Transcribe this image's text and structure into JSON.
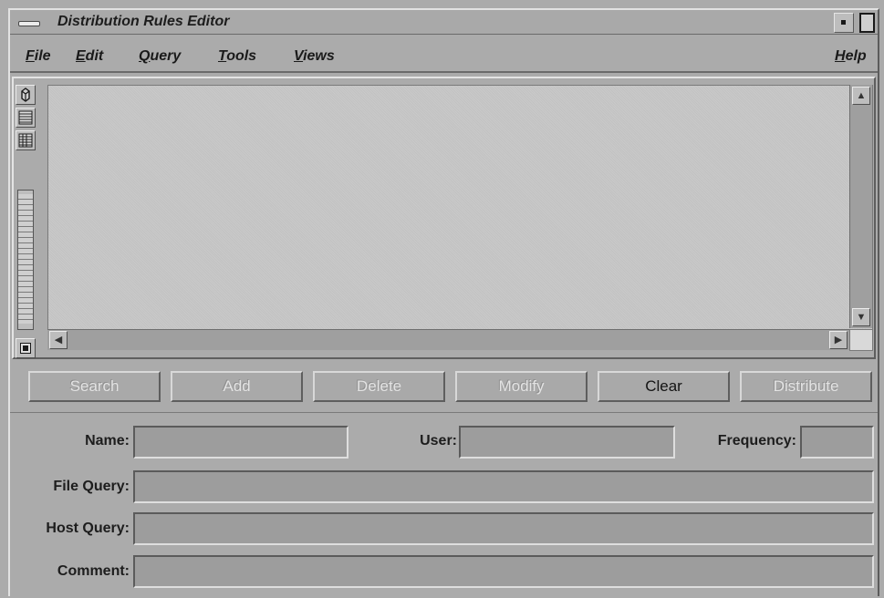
{
  "window": {
    "title": "Distribution Rules Editor"
  },
  "menubar": {
    "items": [
      {
        "mnemonic": "F",
        "rest": "ile"
      },
      {
        "mnemonic": "E",
        "rest": "dit"
      },
      {
        "mnemonic": "Q",
        "rest": "uery"
      },
      {
        "mnemonic": "T",
        "rest": "ools"
      },
      {
        "mnemonic": "V",
        "rest": "iews"
      }
    ],
    "help": {
      "mnemonic": "H",
      "rest": "elp"
    }
  },
  "view_toolbar": {
    "icons": [
      "cube-view-icon",
      "list-view-icon",
      "table-view-icon",
      "zoom-slider",
      "overview-icon"
    ]
  },
  "buttons": {
    "search": "Search",
    "add": "Add",
    "delete": "Delete",
    "modify": "Modify",
    "clear": "Clear",
    "distribute": "Distribute"
  },
  "button_states": {
    "search": "disabled",
    "add": "disabled",
    "delete": "disabled",
    "modify": "disabled",
    "clear": "enabled",
    "distribute": "disabled"
  },
  "form": {
    "name_label": "Name:",
    "name_value": "",
    "user_label": "User:",
    "user_value": "",
    "frequency_label": "Frequency:",
    "frequency_value": "",
    "file_query_label": "File Query:",
    "file_query_value": "",
    "host_query_label": "Host Query:",
    "host_query_value": "",
    "comment_label": "Comment:",
    "comment_value": ""
  }
}
